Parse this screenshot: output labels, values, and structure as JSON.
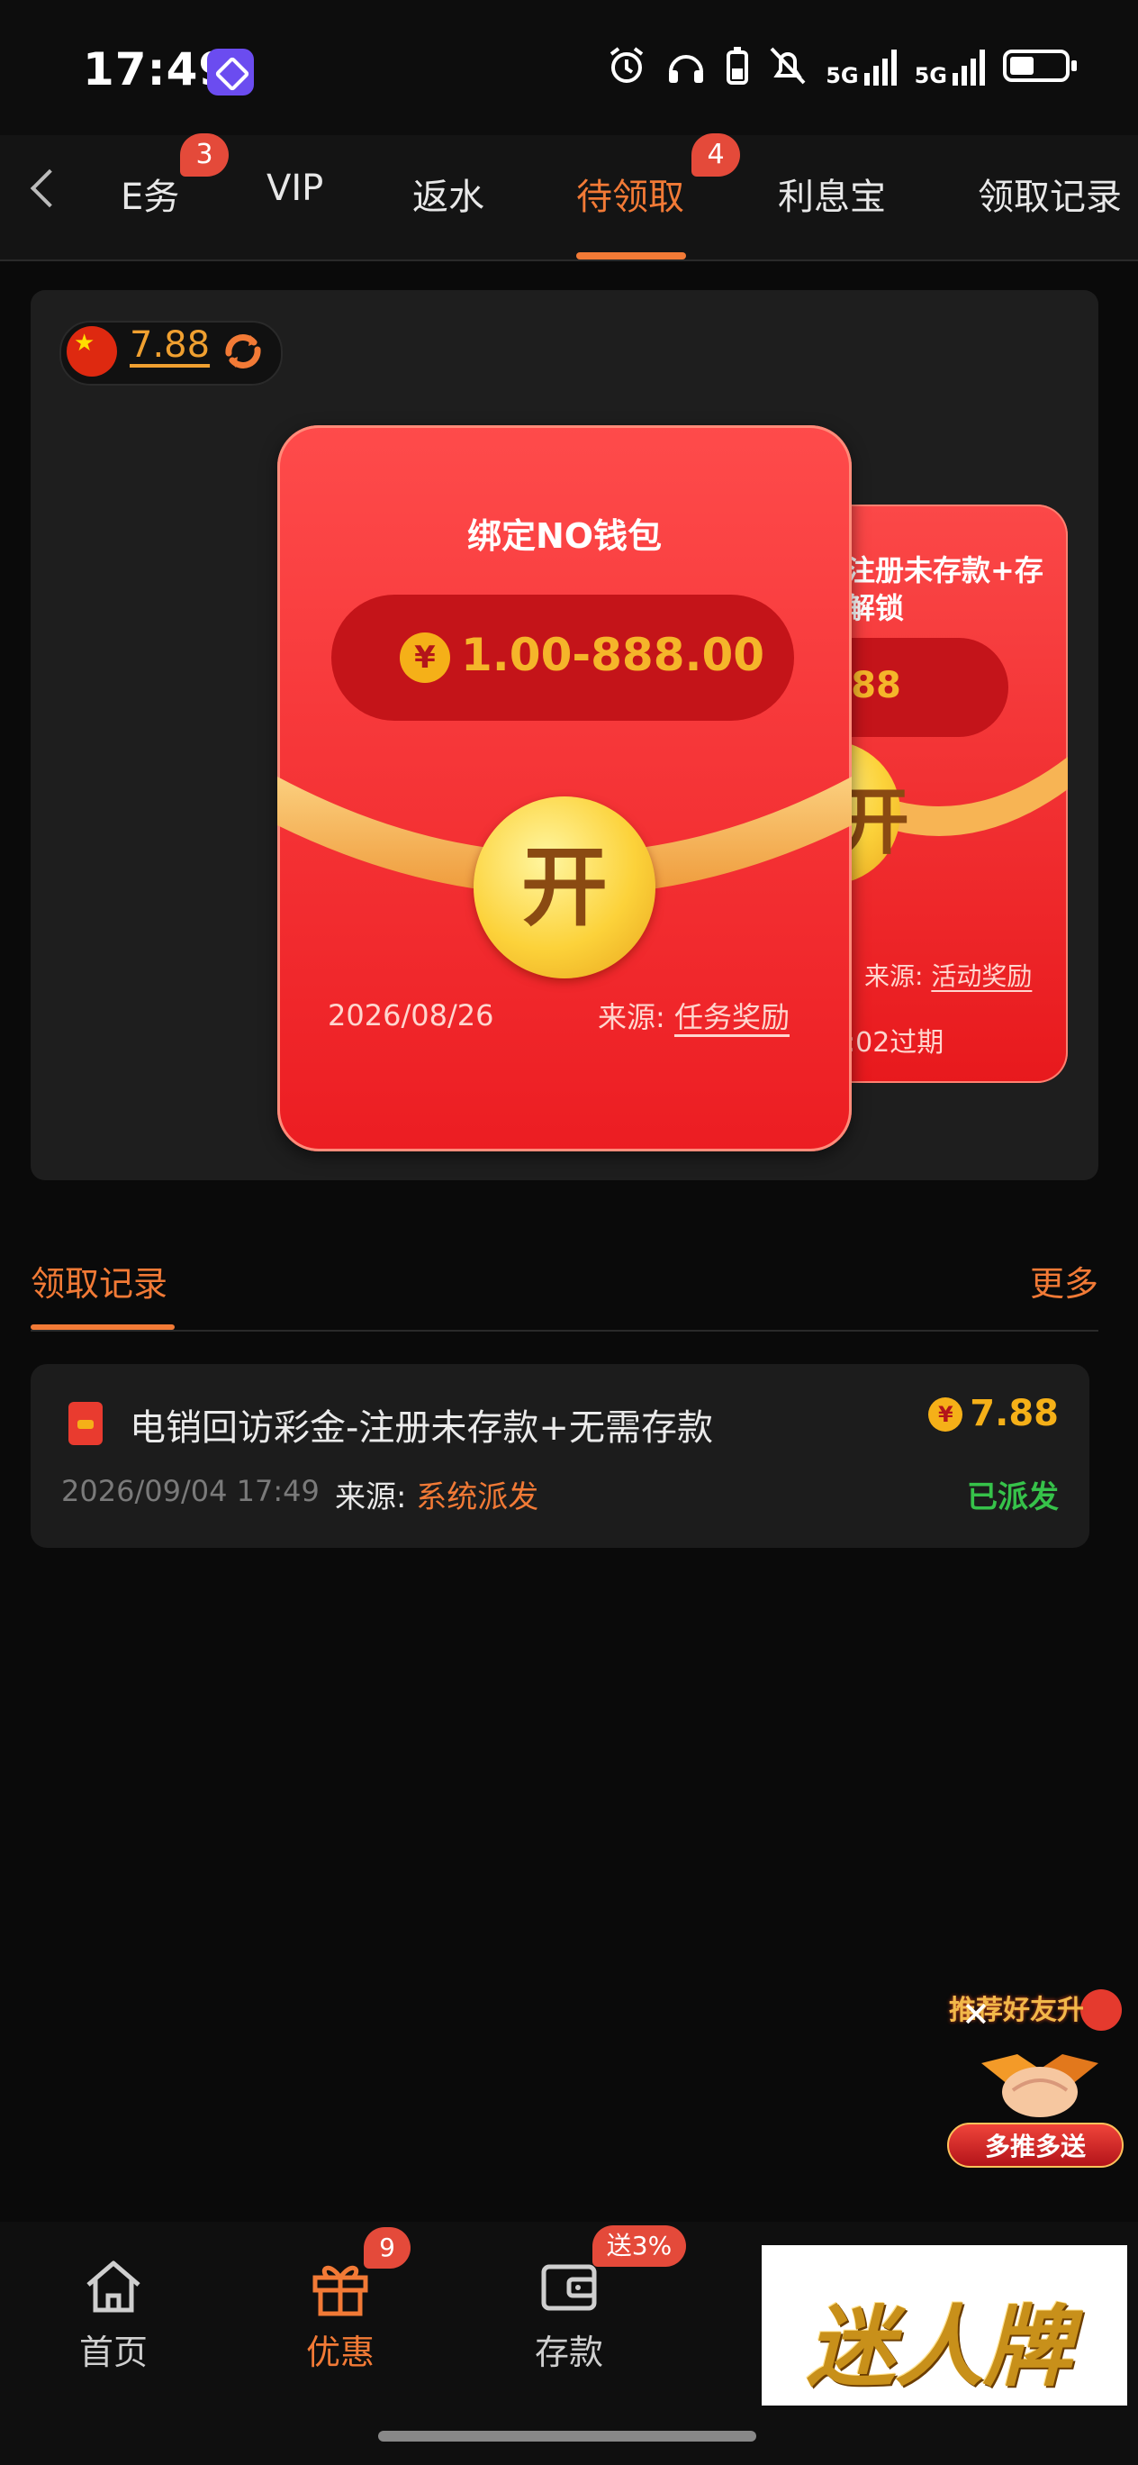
{
  "status_bar": {
    "time": "17:49",
    "network_1": "5G",
    "network_2": "5G"
  },
  "tabs": [
    {
      "label": "任务",
      "display": "E务",
      "badge": "3"
    },
    {
      "label": "VIP",
      "display": "VIP"
    },
    {
      "label": "返水",
      "display": "返水"
    },
    {
      "label": "待领取",
      "display": "待领取",
      "badge": "4",
      "active": true
    },
    {
      "label": "利息宝",
      "display": "利息宝"
    },
    {
      "label": "领取记录",
      "display": "领取记录"
    }
  ],
  "balance": {
    "value": "7.88"
  },
  "envelope_front": {
    "title": "绑定NO钱包",
    "currency_symbol": "¥",
    "amount_range": "1.00-888.00",
    "open_label": "开",
    "date": "2026/08/26",
    "source_label": "来源:",
    "source_value": "任务奖励"
  },
  "envelope_back": {
    "title_line1": "注册未存款+存",
    "title_line2": "解锁",
    "amount_partial": ".88",
    "open_label_partial": "开",
    "source_label": "来源:",
    "source_value": "活动奖励",
    "expire_text": ":02过期"
  },
  "records": {
    "title": "领取记录",
    "more_label": "更多",
    "items": [
      {
        "name": "电销回访彩金-注册未存款+无需存款",
        "currency_symbol": "¥",
        "amount": "7.88",
        "datetime": "2026/09/04 17:49",
        "source_label": "来源:",
        "source_value": "系统派发",
        "status": "已派发"
      }
    ]
  },
  "promo": {
    "title": "推荐好友升",
    "button_label": "多推多送",
    "close_symbol": "✕"
  },
  "bottom_nav": {
    "items": [
      {
        "label": "首页",
        "icon": "home-icon"
      },
      {
        "label": "优惠",
        "icon": "gift-icon",
        "badge": "9",
        "active": true
      },
      {
        "label": "存款",
        "icon": "wallet-icon",
        "badge": "送3%"
      }
    ],
    "ad_text": "迷人牌"
  },
  "colors": {
    "accent": "#f27a36",
    "envelope_red": "#ec1d22",
    "gold": "#f5b018",
    "success": "#36c24a",
    "badge": "#e44a3a"
  }
}
